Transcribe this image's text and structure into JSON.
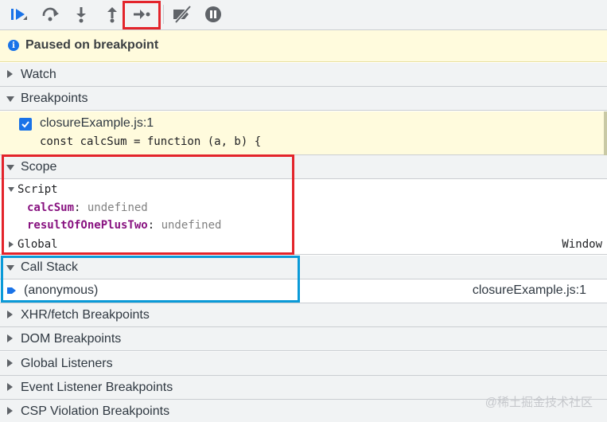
{
  "toolbar": {
    "buttons": [
      {
        "name": "resume-icon"
      },
      {
        "name": "step-over-icon"
      },
      {
        "name": "step-into-icon"
      },
      {
        "name": "step-out-icon"
      },
      {
        "name": "step-icon"
      },
      {
        "name": "deactivate-breakpoints-icon"
      },
      {
        "name": "pause-on-exceptions-icon"
      }
    ],
    "colors": {
      "accent": "#1a73e8",
      "icon": "#5f6368",
      "highlight": "#e3242b"
    }
  },
  "status": {
    "text": "Paused on breakpoint"
  },
  "panes": {
    "watch": {
      "label": "Watch"
    },
    "breakpoints": {
      "label": "Breakpoints",
      "item": {
        "file": "closureExample.js:1",
        "code": "const calcSum = function (a, b) {",
        "checked": true
      }
    },
    "scope": {
      "label": "Scope",
      "script_label": "Script",
      "props": [
        {
          "name": "calcSum",
          "value": "undefined"
        },
        {
          "name": "resultOfOnePlusTwo",
          "value": "undefined"
        }
      ],
      "global_label": "Global",
      "global_value": "Window"
    },
    "call_stack": {
      "label": "Call Stack",
      "frame": {
        "name": "(anonymous)",
        "location": "closureExample.js:1"
      }
    },
    "xhr": {
      "label": "XHR/fetch Breakpoints"
    },
    "dom": {
      "label": "DOM Breakpoints"
    },
    "global_listeners": {
      "label": "Global Listeners"
    },
    "event_listeners": {
      "label": "Event Listener Breakpoints"
    },
    "csp": {
      "label": "CSP Violation Breakpoints"
    }
  },
  "watermark": "@稀土掘金技术社区"
}
